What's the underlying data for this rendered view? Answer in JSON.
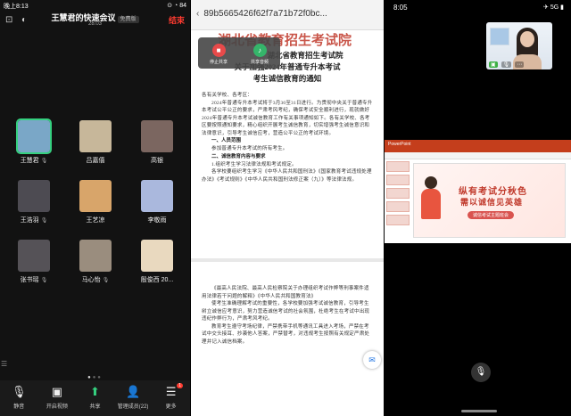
{
  "phone1": {
    "status_time": "晚上8:13",
    "status_icons": "⊙ ◔ 84",
    "meeting_title": "王慧君的快速会议",
    "meeting_badge": "免费版",
    "meeting_time": "28:03",
    "end_label": "结束",
    "participants": [
      {
        "name": "王慧君",
        "speaking": true,
        "color": "#7aa7c7"
      },
      {
        "name": "吕嘉僖",
        "speaking": false,
        "color": "#c7b79a"
      },
      {
        "name": "高银",
        "speaking": false,
        "color": "#7b6660"
      },
      {
        "name": "王浩羽",
        "speaking": false,
        "color": "#4d4b52"
      },
      {
        "name": "王艺凉",
        "speaking": false,
        "color": "#d8a56a"
      },
      {
        "name": "李敬雨",
        "speaking": false,
        "color": "#aab8dd"
      },
      {
        "name": "张书瑶",
        "speaking": false,
        "color": "#555257"
      },
      {
        "name": "马心怡",
        "speaking": false,
        "color": "#9a8d7e"
      },
      {
        "name": "殷俊西 20...",
        "speaking": false,
        "color": "#e9d9bf"
      }
    ],
    "toolbar": [
      {
        "label": "静音",
        "icon": "🎙"
      },
      {
        "label": "开启视频",
        "icon": "▣"
      },
      {
        "label": "共享",
        "icon": "⬆"
      },
      {
        "label": "管理成员(22)",
        "icon": "👤"
      },
      {
        "label": "更多",
        "icon": "☰",
        "badge": "1"
      }
    ]
  },
  "phone2": {
    "url": "89b5665426f62f7a71b72f0bc...",
    "share_stop_label": "停止共享",
    "share_audio_label": "共享音频",
    "seal_text": "湖北省教育招生考试院",
    "doc_title_1": "湖北省教育招生考试院",
    "doc_title_2": "关于加强2024年普通专升本考试",
    "doc_title_3": "考生诚信教育的通知",
    "salutation": "各有关学校、各考区：",
    "para1": "2024年普通专升本考试将于3月30至31日进行。为贯彻中央关于普通专升本考试公平公正的要求，严肃考风考纪，确保考试安全顺利进行，现就做好2024年普通专升本考试诚信教育工作有关事项通知如下。各有关学校、各考区要按照通知要求，精心组织开展考生诚信教育，切实增强考生诚信意识和法律意识，引导考生诚信应考，营造公平公正的考试环境。",
    "heading1": "一、人员范围",
    "para2": "参加普通专升本考试的所有考生。",
    "heading2": "二、诚信教育内容与要求",
    "para3": "1.组织考生学习法律法规和考试规定。",
    "para4": "各学校要组织考生学习《中华人民共和国刑法》《国家教育考试违规处理办法》《考试规则》《中华人民共和国刑法修正案（九）》等法律法规。",
    "para5": "《最高人民法院、最高人民检察院关于办理组织考试作弊等刑事案件适用法律若干问题的解释》《中华人民共和国教育法》",
    "para6": "使考生准确理解考试的重要性，各学校要加强考试诚信教育，引导考生树立诚信应考意识，努力营造诚信考试的社会氛围，杜绝考生在考试中出现违纪作弊行为，严肃考风考纪。",
    "para7": "教育考生遵守考场纪律，严禁携带手机等通讯工具进入考场，严禁在考试中交头接耳、抄袭他人答案，严禁替考，对违规考生按照有关规定严肃处理并记入诚信档案。"
  },
  "phone3": {
    "status_time": "8:05",
    "status_icons": "✈ 5G ▮",
    "video_ctrls": [
      "🎙",
      "⋯"
    ],
    "ppt_app": "PowerPoint",
    "banner_line1": "纵有考试分秋色",
    "banner_line2": "需以诚信见英雄",
    "banner_sub": "诚信考试主题班会",
    "mic_icon": "🎙"
  }
}
